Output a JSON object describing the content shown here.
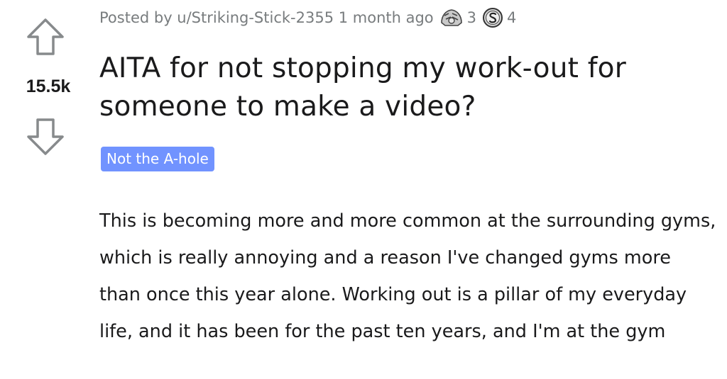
{
  "vote": {
    "score": "15.5k",
    "upvote_icon": "arrow-up-outline-icon",
    "downvote_icon": "arrow-down-outline-icon"
  },
  "post": {
    "author_line": "Posted by u/Striking-Stick-2355 1 month ago",
    "awards": [
      {
        "icon": "wholesome-award-icon",
        "count": "3"
      },
      {
        "icon": "silver-award-icon",
        "count": "4"
      }
    ],
    "title": "AITA for not stopping my work-out for someone to make a video?",
    "flair": "Not the A-hole",
    "body": "This is becoming more and more common at the surrounding gyms, which is really annoying and a reason I've changed gyms more than once this year alone. Working out is a pillar of my everyday life, and it has been for the past ten years, and I'm at the gym"
  },
  "colors": {
    "meta_text": "#787c7e",
    "flair_background": "#7193ff",
    "flair_text": "#ffffff",
    "body_text": "#1a1a1b"
  }
}
